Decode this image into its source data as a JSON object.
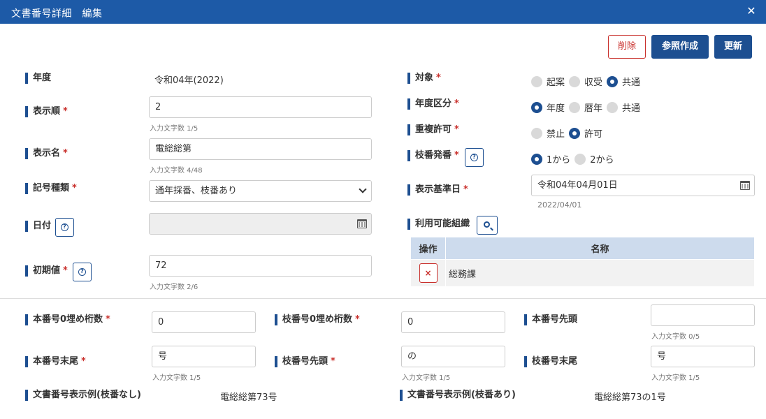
{
  "window": {
    "title": "文書番号詳細　編集"
  },
  "toolbar": {
    "delete_label": "削除",
    "reference_label": "参照作成",
    "update_label": "更新"
  },
  "required_mark": "*",
  "help_mark": "?",
  "fields": {
    "fiscal_year": {
      "label": "年度",
      "value": "令和04年(2022)"
    },
    "display_order": {
      "label": "表示順",
      "value": "2",
      "hint": "入力文字数 1/5"
    },
    "display_name": {
      "label": "表示名",
      "value": "電総総第",
      "hint": "入力文字数 4/48"
    },
    "symbol_type": {
      "label": "記号種類",
      "value": "通年採番、枝番あり"
    },
    "date": {
      "label": "日付",
      "value": ""
    },
    "initial_value": {
      "label": "初期値",
      "value": "72",
      "hint": "入力文字数 2/6"
    },
    "target": {
      "label": "対象",
      "options": [
        "起案",
        "収受",
        "共通"
      ],
      "selected": "共通"
    },
    "year_division": {
      "label": "年度区分",
      "options": [
        "年度",
        "暦年",
        "共通"
      ],
      "selected": "年度"
    },
    "duplicate_allowed": {
      "label": "重複許可",
      "options": [
        "禁止",
        "許可"
      ],
      "selected": "許可"
    },
    "branch_issue": {
      "label": "枝番発番",
      "options": [
        "1から",
        "2から"
      ],
      "selected": "1から"
    },
    "display_base_date": {
      "label": "表示基準日",
      "value": "令和04年04月01日",
      "sub": "2022/04/01"
    },
    "available_orgs": {
      "label": "利用可能組織",
      "columns": [
        "操作",
        "名称"
      ],
      "rows": [
        {
          "delete_icon": "×",
          "name": "総務課"
        }
      ]
    },
    "main_zero_pad": {
      "label": "本番号0埋め桁数",
      "value": "0"
    },
    "branch_zero_pad": {
      "label": "枝番号0埋め桁数",
      "value": "0"
    },
    "main_prefix": {
      "label": "本番号先頭",
      "value": "",
      "hint": "入力文字数 0/5"
    },
    "main_suffix": {
      "label": "本番号末尾",
      "value": "号",
      "hint": "入力文字数 1/5"
    },
    "branch_prefix": {
      "label": "枝番号先頭",
      "value": "の",
      "hint": "入力文字数 1/5"
    },
    "branch_suffix": {
      "label": "枝番号末尾",
      "value": "号",
      "hint": "入力文字数 1/5"
    },
    "example_no_branch": {
      "label": "文書番号表示例(枝番なし)",
      "value": "電総総第73号"
    },
    "example_with_branch": {
      "label": "文書番号表示例(枝番あり)",
      "value": "電総総第73の1号"
    }
  },
  "colors": {
    "header": "#1d5aa7",
    "primary": "#1d4f91",
    "danger": "#c9302c",
    "table_header": "#cddbed"
  },
  "icons": [
    "close-icon",
    "help-icon",
    "calendar-icon",
    "chevron-down-icon",
    "search-icon",
    "delete-icon"
  ]
}
